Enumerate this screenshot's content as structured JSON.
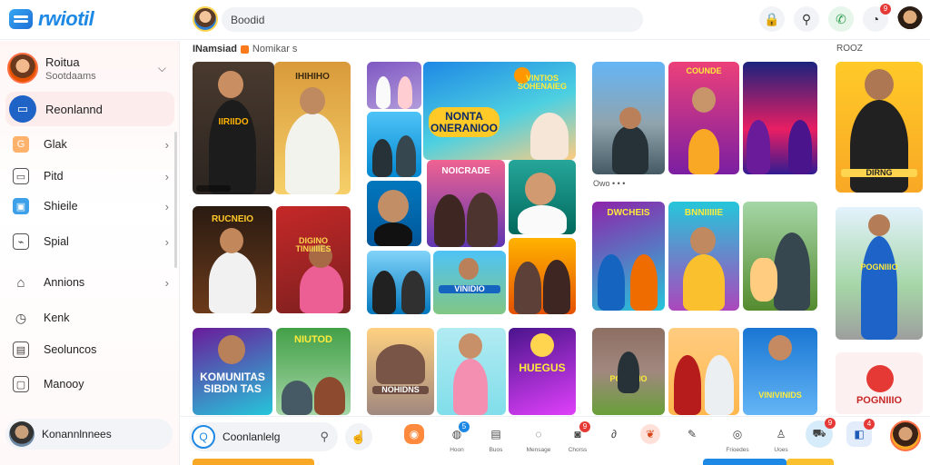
{
  "app": {
    "logo_text": "rwiotil"
  },
  "search": {
    "placeholder": "Boodid"
  },
  "topbar": {
    "icons": [
      {
        "name": "lock-icon",
        "glyph": "🔒",
        "badge": ""
      },
      {
        "name": "search-icon",
        "glyph": "⚲",
        "badge": ""
      },
      {
        "name": "phone-icon",
        "glyph": "✆",
        "badge": ""
      },
      {
        "name": "notification-icon",
        "glyph": "◔",
        "badge": "9"
      }
    ]
  },
  "sidebar": {
    "profile": {
      "name": "Roitua",
      "subtitle": "Sootdaams"
    },
    "active_item": {
      "label": "Reonlannd",
      "icon": "inbox-icon"
    },
    "items": [
      {
        "label": "Glak",
        "icon": "play-icon",
        "glyph": "G",
        "style": "orange",
        "arrow": true
      },
      {
        "label": "Pitd",
        "icon": "bookmark-icon",
        "glyph": "▭",
        "style": "",
        "arrow": true
      },
      {
        "label": "Shieile",
        "icon": "share-icon",
        "glyph": "▣",
        "style": "blue",
        "arrow": true
      },
      {
        "label": "Spial",
        "icon": "tag-icon",
        "glyph": "⌁",
        "style": "",
        "arrow": true
      },
      {
        "label": "Annions",
        "icon": "home-icon",
        "glyph": "⌂",
        "style": "",
        "arrow": true
      },
      {
        "label": "Kenk",
        "icon": "clock-icon",
        "glyph": "◷",
        "style": "",
        "arrow": false
      },
      {
        "label": "Seoluncos",
        "icon": "folder-icon",
        "glyph": "▤",
        "style": "",
        "arrow": false
      },
      {
        "label": "Manooy",
        "icon": "wallet-icon",
        "glyph": "▢",
        "style": "",
        "arrow": false
      }
    ],
    "bottom_user": {
      "label": "Konannlnnees"
    }
  },
  "feed": {
    "header_title": "INamsiad",
    "header_sub": "Nomikar s",
    "right_header": "ROOZ",
    "mid_label": "Owo • • •",
    "card_texts": {
      "c1": "IIRIIDO",
      "c2": "IHIHIHO",
      "c4": "RUCNEIO",
      "c5": "DIGINO TINIIIIIES",
      "c7": "KOMUNITAS SIBDN TAS",
      "c8": "NIUTOD",
      "c10": "NONTA ONERANIOO",
      "c11": "VINTIOS SOHENAIEG",
      "c12": "NOICRADE",
      "c20": "VINIDIO",
      "c26": "NOHIDNS",
      "c27": "HUEGUS",
      "c28": "COUNDE",
      "c31": "VINIVINIDS",
      "c33": "DWCHEIS",
      "c35": "BNNIIIIIE",
      "c36": "POGNIIIO",
      "c37": "DIRNG"
    }
  },
  "bottombar": {
    "search_label": "Coonlanlelg",
    "items": [
      {
        "name": "orange-app-icon",
        "glyph": "◉",
        "label": "",
        "bg": "#ff8a3d",
        "badge": ""
      },
      {
        "name": "chat-icon",
        "glyph": "◍",
        "label": "Hoon",
        "bg": "",
        "badge": "5"
      },
      {
        "name": "document-icon",
        "glyph": "▤",
        "label": "Buos",
        "bg": "",
        "badge": ""
      },
      {
        "name": "message-icon",
        "glyph": "◌",
        "label": "Mensage",
        "bg": "",
        "badge": ""
      },
      {
        "name": "camera-icon",
        "glyph": "◙",
        "label": "Chorss",
        "bg": "",
        "badge": "9"
      },
      {
        "name": "link-icon",
        "glyph": "∂",
        "label": "",
        "bg": "",
        "badge": ""
      },
      {
        "name": "red-app-icon",
        "glyph": "❦",
        "label": "",
        "bg": "#ffe1d9",
        "badge": ""
      },
      {
        "name": "pen-icon",
        "glyph": "✎",
        "label": "",
        "bg": "",
        "badge": ""
      },
      {
        "name": "people-icon",
        "glyph": "◎",
        "label": "Frioedes",
        "bg": "",
        "badge": ""
      },
      {
        "name": "person-icon",
        "glyph": "♙",
        "label": "Uoes",
        "bg": "",
        "badge": ""
      },
      {
        "name": "cart-icon",
        "glyph": "⛟",
        "label": "",
        "bg": "#d6ecfa",
        "badge": "9"
      },
      {
        "name": "app-icon",
        "glyph": "◧",
        "label": "",
        "bg": "#e3ecfb",
        "badge": "4"
      }
    ]
  },
  "colors": {
    "accent": "#1e88e5",
    "badge": "#e53935",
    "active_bg": "#fdecec"
  }
}
